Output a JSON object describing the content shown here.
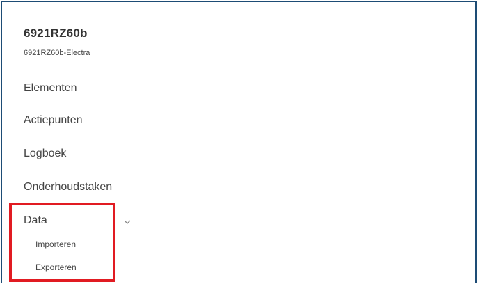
{
  "header": {
    "title": "6921RZ60b",
    "subtitle": "6921RZ60b-Electra"
  },
  "nav": {
    "items": [
      {
        "label": "Elementen"
      },
      {
        "label": "Actiepunten"
      },
      {
        "label": "Logboek"
      },
      {
        "label": "Onderhoudstaken"
      },
      {
        "label": "Data"
      }
    ],
    "data_subitems": [
      {
        "label": "Importeren"
      },
      {
        "label": "Exporteren"
      }
    ]
  },
  "icons": {
    "data_chevron": "chevron-down-icon"
  },
  "colors": {
    "frame_border": "#1d4c75",
    "highlight_border": "#e11b22",
    "text": "#444444"
  }
}
